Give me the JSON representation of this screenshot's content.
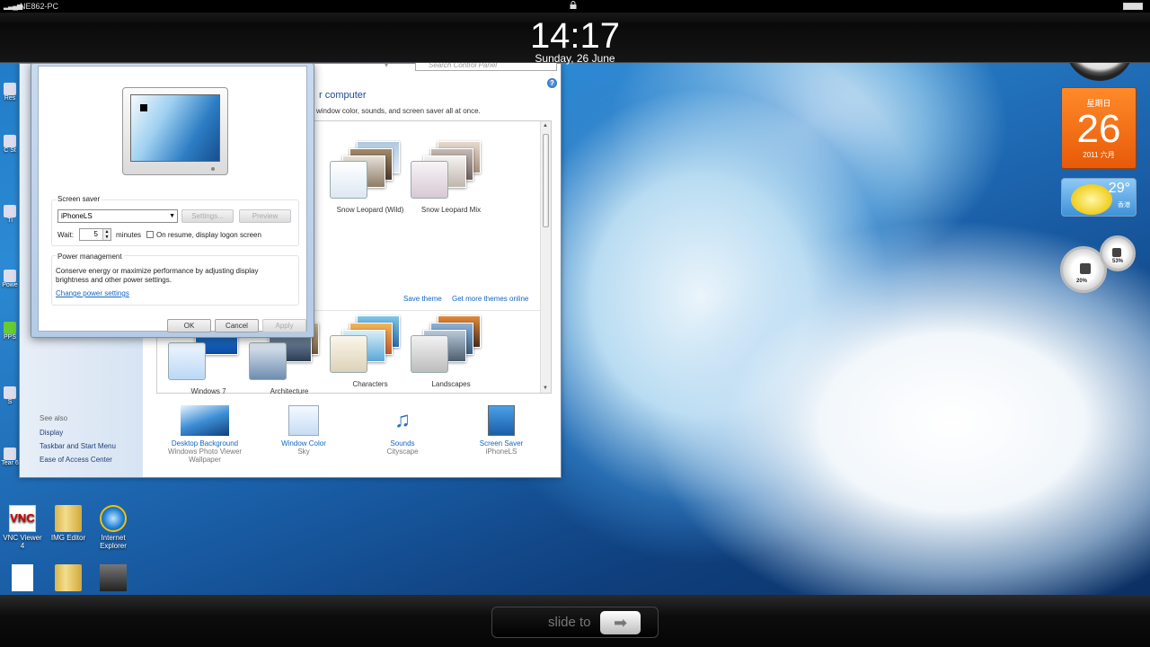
{
  "lockscreen": {
    "carrier": "NE862-PC",
    "time": "14:17",
    "date": "Sunday, 26 June",
    "slide_text": "slide to"
  },
  "control_panel": {
    "search_placeholder": "Search Control Panel",
    "heading": "r computer",
    "subtitle": "window color, sounds, and screen saver all at once.",
    "themes_top": [
      {
        "label": "Snow Leopard (Wild)"
      },
      {
        "label": "Snow Leopard Mix"
      }
    ],
    "save_theme": "Save theme",
    "get_more": "Get more themes online",
    "themes_bottom": [
      {
        "label": "Windows 7"
      },
      {
        "label": "Architecture"
      },
      {
        "label": "Characters"
      },
      {
        "label": "Landscapes"
      }
    ],
    "see_also": {
      "heading": "See also",
      "links": [
        "Display",
        "Taskbar and Start Menu",
        "Ease of Access Center"
      ]
    },
    "bottom_items": [
      {
        "title": "Desktop Background",
        "value": "Windows Photo Viewer Wallpaper",
        "icon": "wallpaper-icon"
      },
      {
        "title": "Window Color",
        "value": "Sky",
        "icon": "window-color-icon"
      },
      {
        "title": "Sounds",
        "value": "Cityscape",
        "icon": "sounds-icon"
      },
      {
        "title": "Screen Saver",
        "value": "iPhoneLS",
        "icon": "screen-saver-icon"
      }
    ]
  },
  "screensaver_dialog": {
    "group_label": "Screen saver",
    "selected": "iPhoneLS",
    "settings_label": "Settings...",
    "preview_label": "Preview",
    "wait_label": "Wait:",
    "wait_value": "5",
    "minutes_label": "minutes",
    "resume_label": "On resume, display logon screen",
    "power_heading": "Power management",
    "power_text": "Conserve energy or maximize performance by adjusting display brightness and other power settings.",
    "power_link": "Change power settings",
    "ok": "OK",
    "cancel": "Cancel",
    "apply": "Apply"
  },
  "gadgets": {
    "calendar": {
      "weekday": "星期日",
      "day": "26",
      "month_year": "2011 六月"
    },
    "weather": {
      "temp": "29°",
      "city": "香港"
    },
    "meter": {
      "cpu": "20%",
      "ram": "53%"
    }
  },
  "desktop_icons": [
    {
      "label": "VNC Viewer 4"
    },
    {
      "label": "IMG Editor"
    },
    {
      "label": "Internet Explorer"
    }
  ],
  "edge_icons": [
    {
      "label": "Res"
    },
    {
      "label": "C St"
    },
    {
      "label": "Tl"
    },
    {
      "label": "Powe"
    },
    {
      "label": "PPS"
    },
    {
      "label": "S"
    },
    {
      "label": "Tear 6"
    }
  ]
}
